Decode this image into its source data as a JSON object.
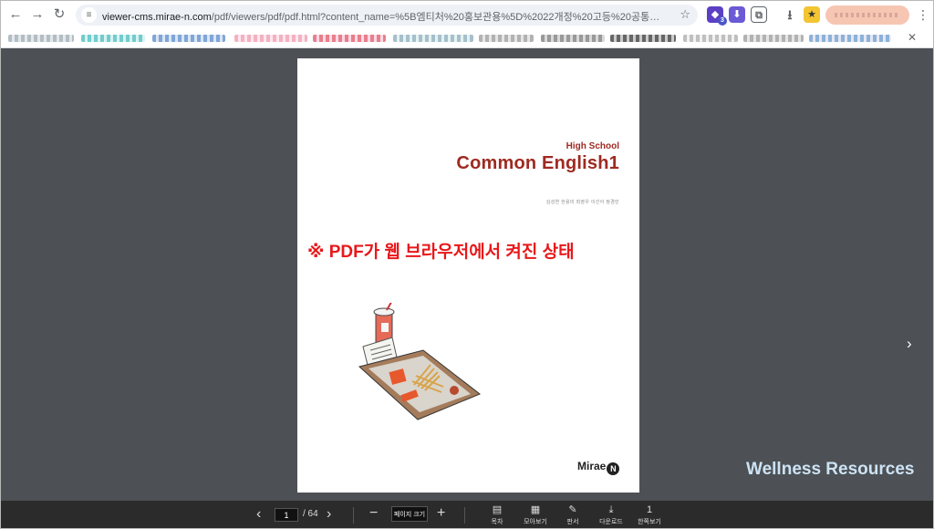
{
  "browser": {
    "url_host": "viewer-cms.mirae-n.com",
    "url_rest": "/pdf/viewers/pdf/pdf.html?content_name=%5B엠티처%20홍보관용%5D%2022개정%20고등%20공통영어1%20교과서%20P...",
    "ext_badge": "3"
  },
  "icons": {
    "back": "←",
    "forward": "→",
    "reload": "↻",
    "star": "☆",
    "download": "⭳",
    "menu": "⋮",
    "close": "✕"
  },
  "cover": {
    "subtitle": "High School",
    "title": "Common English1",
    "authors": "김성연 한용미 최영우 이선아 정경민",
    "publisher": "Mirae",
    "publisher_mark": "N"
  },
  "annotation": "※ PDF가 웹 브라우저에서 켜진 상태",
  "watermark": "Wellness Resources",
  "bottom": {
    "prev": "‹",
    "page": "1",
    "total": "/ 64",
    "next": "›",
    "zoom_out": "−",
    "zoom_label": "페이지 크기",
    "zoom_in": "+",
    "tools": [
      {
        "label": "목차",
        "icon": "▤"
      },
      {
        "label": "모아보기",
        "icon": "▦"
      },
      {
        "label": "판서",
        "icon": "✎"
      },
      {
        "label": "다운로드",
        "icon": "⤓"
      },
      {
        "label": "한쪽보기",
        "icon": "1"
      }
    ]
  },
  "colors": {
    "title_red": "#9e2a21",
    "annotation_red": "#e8181b",
    "viewer_bg": "#4d5155",
    "bar_bg": "#2b2b2b"
  }
}
